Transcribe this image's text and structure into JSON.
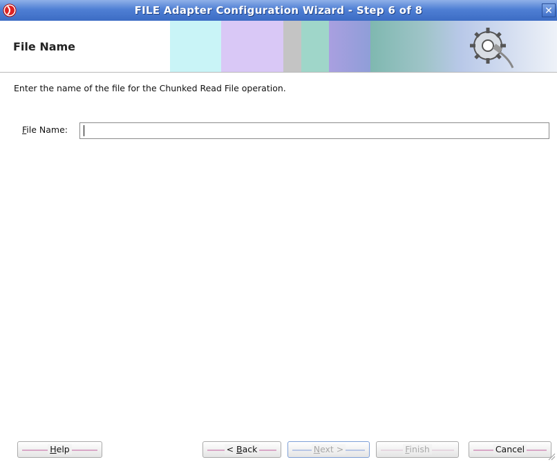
{
  "window": {
    "title": "FILE Adapter Configuration Wizard - Step 6 of 8",
    "close_symbol": "✕"
  },
  "header": {
    "title": "File Name"
  },
  "main": {
    "instructions": "Enter the name of the file for the Chunked Read File operation.",
    "file_name": {
      "label_mnemonic": "F",
      "label_rest": "ile Name:",
      "value": "",
      "placeholder": ""
    }
  },
  "buttons": {
    "help": {
      "mnemonic": "H",
      "rest": "elp"
    },
    "back": {
      "prefix": "< ",
      "mnemonic": "B",
      "rest": "ack"
    },
    "next": {
      "mnemonic": "N",
      "rest": "ext >"
    },
    "finish": {
      "mnemonic": "F",
      "rest": "inish"
    },
    "cancel": {
      "label": "Cancel"
    }
  },
  "colors": {
    "titlebar": "#4f7fd4",
    "stripe": "#d8a7c7"
  }
}
